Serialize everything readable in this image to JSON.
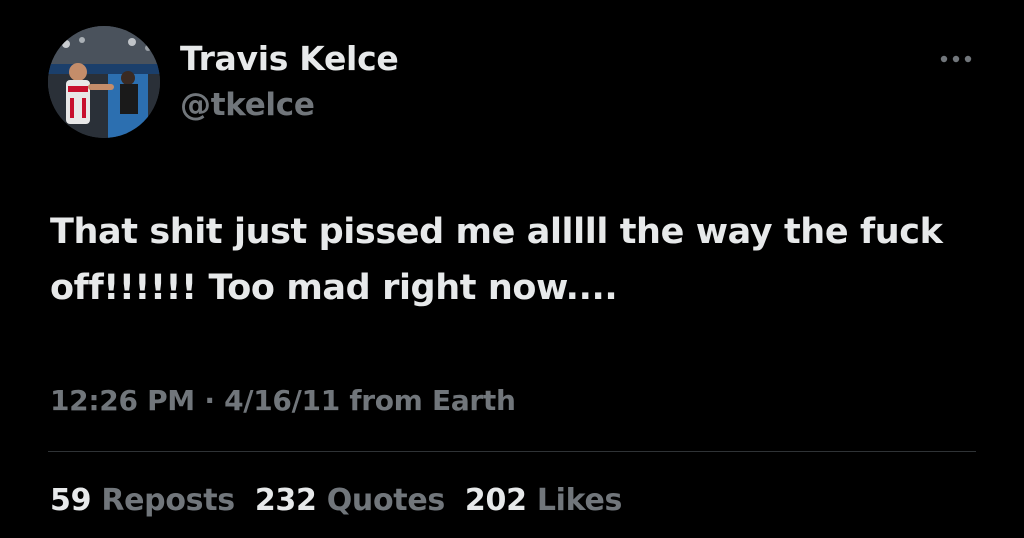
{
  "author": {
    "display_name": "Travis Kelce",
    "handle": "@tkelce",
    "avatar_icon": "profile-photo"
  },
  "more_icon": "ellipsis-icon",
  "tweet": {
    "text": "That shit just pissed me alllll the way the fuck off!!!!!! Too mad right now....",
    "time": "12:26 PM",
    "separator": "·",
    "date": "4/16/11",
    "source": "from Earth"
  },
  "stats": {
    "reposts": {
      "count": "59",
      "label": "Reposts"
    },
    "quotes": {
      "count": "232",
      "label": "Quotes"
    },
    "likes": {
      "count": "202",
      "label": "Likes"
    }
  },
  "colors": {
    "background": "#000000",
    "primary_text": "#e7e9ea",
    "secondary_text": "#71767b",
    "divider": "#2f3336"
  }
}
